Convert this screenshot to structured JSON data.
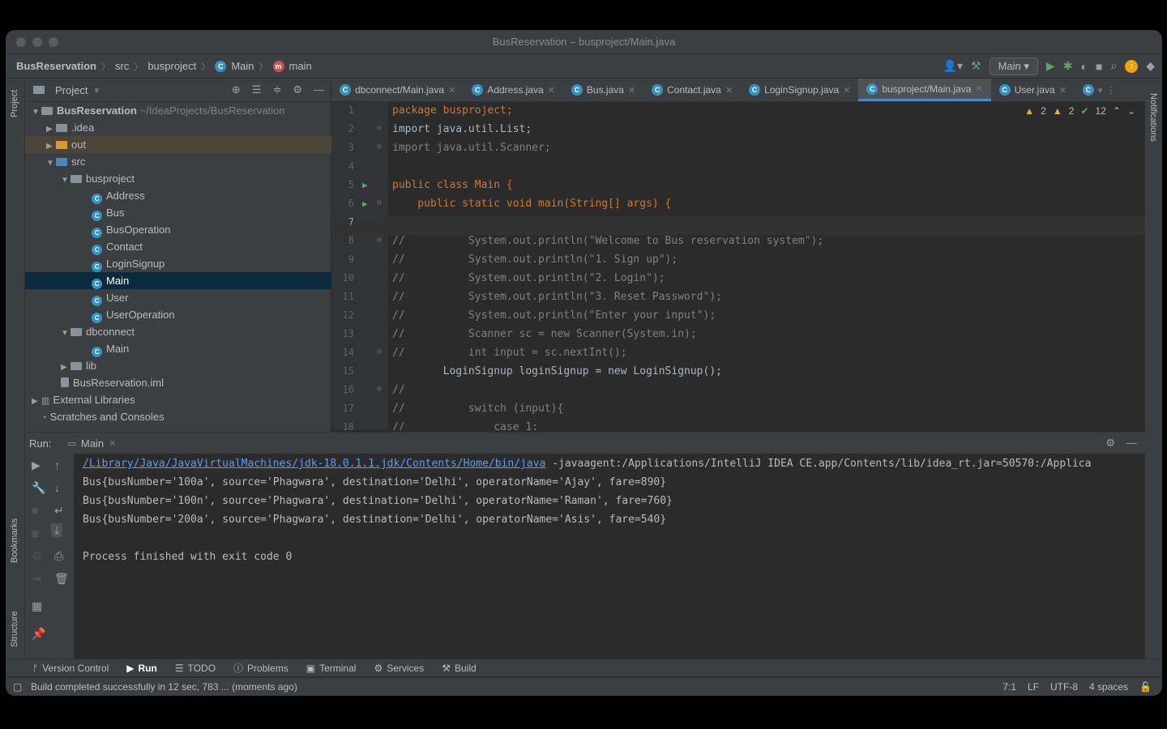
{
  "window": {
    "title": "BusReservation – busproject/Main.java"
  },
  "navbar": {
    "breadcrumbs": [
      "BusReservation",
      "src",
      "busproject",
      "Main",
      "main"
    ],
    "run_config": "Main"
  },
  "left_tool": {
    "project": "Project",
    "bookmarks": "Bookmarks",
    "structure": "Structure"
  },
  "right_tool": {
    "notifications": "Notifications"
  },
  "project_panel": {
    "title": "Project",
    "root": {
      "name": "BusReservation",
      "path": "~/IdeaProjects/BusReservation"
    },
    "items": [
      "BusReservation",
      ".idea",
      "out",
      "src",
      "busproject",
      "Address",
      "Bus",
      "BusOperation",
      "Contact",
      "LoginSignup",
      "Main",
      "User",
      "UserOperation",
      "dbconnect",
      "Main",
      "lib",
      "BusReservation.iml",
      "External Libraries",
      "Scratches and Consoles"
    ]
  },
  "tabs": [
    "dbconnect/Main.java",
    "Address.java",
    "Bus.java",
    "Contact.java",
    "LoginSignup.java",
    "busproject/Main.java",
    "User.java"
  ],
  "inspections": {
    "warnings": "2",
    "weak_warnings": "2",
    "typos": "12"
  },
  "editor": {
    "line_numbers": [
      "1",
      "2",
      "3",
      "4",
      "5",
      "6",
      "7",
      "8",
      "9",
      "10",
      "11",
      "12",
      "13",
      "14",
      "15",
      "16",
      "17",
      "18"
    ],
    "lines": [
      "package busproject;",
      "import java.util.List;",
      "import java.util.Scanner;",
      "",
      "public class Main {",
      "    public static void main(String[] args) {",
      "",
      "//          System.out.println(\"Welcome to Bus reservation system\");",
      "//          System.out.println(\"1. Sign up\");",
      "//          System.out.println(\"2. Login\");",
      "//          System.out.println(\"3. Reset Password\");",
      "//          System.out.println(\"Enter your input\");",
      "//          Scanner sc = new Scanner(System.in);",
      "//          int input = sc.nextInt();",
      "        LoginSignup loginSignup = new LoginSignup();",
      "//",
      "//          switch (input){",
      "//              case 1:"
    ]
  },
  "run_panel": {
    "label": "Run:",
    "tab": "Main",
    "console": {
      "command_link": "/Library/Java/JavaVirtualMachines/jdk-18.0.1.1.jdk/Contents/Home/bin/java",
      "command_rest": " -javaagent:/Applications/IntelliJ IDEA CE.app/Contents/lib/idea_rt.jar=50570:/Applica",
      "output": [
        "Bus{busNumber='100a', source='Phagwara', destination='Delhi', operatorName='Ajay', fare=890}",
        "Bus{busNumber='100n', source='Phagwara', destination='Delhi', operatorName='Raman', fare=760}",
        "Bus{busNumber='200a', source='Phagwara', destination='Delhi', operatorName='Asis', fare=540}",
        "",
        "Process finished with exit code 0"
      ]
    }
  },
  "bottom_tools": [
    "Version Control",
    "Run",
    "TODO",
    "Problems",
    "Terminal",
    "Services",
    "Build"
  ],
  "status": {
    "message": "Build completed successfully in 12 sec, 783 ... (moments ago)",
    "position": "7:1",
    "line_sep": "LF",
    "encoding": "UTF-8",
    "indent": "4 spaces"
  }
}
